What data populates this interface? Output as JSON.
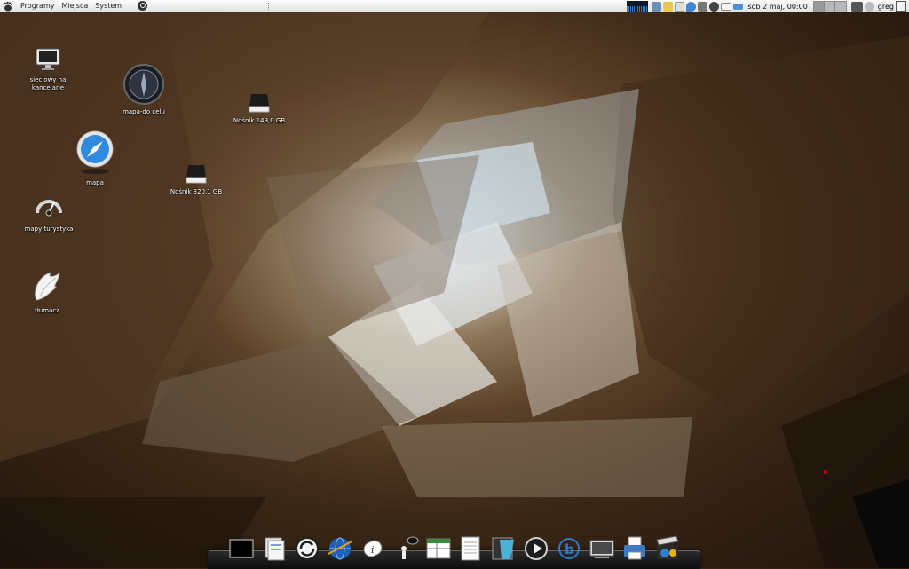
{
  "panel": {
    "menus": [
      "Programy",
      "Miejsca",
      "System"
    ],
    "clock": "sob  2 maj, 00:00",
    "user": "greg"
  },
  "desktop": {
    "icons": [
      {
        "label": "sieciowy na kancelarie",
        "icon": "monitor-icon"
      },
      {
        "label": "mapa-do celu",
        "icon": "dark-compass-icon"
      },
      {
        "label": "Nośnik 149,0 GB",
        "icon": "drive-icon"
      },
      {
        "label": "mapa",
        "icon": "safari-compass-icon"
      },
      {
        "label": "Nośnik 320,1 GB",
        "icon": "drive-icon"
      },
      {
        "label": "mapy turystyka",
        "icon": "gauge-icon"
      },
      {
        "label": "tłumacz",
        "icon": "wing-icon"
      }
    ]
  },
  "dock": {
    "items": [
      "terminal-icon",
      "files-icon",
      "sync-icon",
      "browser-globe-icon",
      "info-icon",
      "chat-icon",
      "spreadsheet-icon",
      "text-document-icon",
      "drawing-icon",
      "media-player-icon",
      "bluetooth-icon",
      "display-icon",
      "printer-icon",
      "clapperboard-icon"
    ]
  },
  "colors": {
    "panel": "#ececec",
    "shelf": "#111111",
    "label_text": "#ffffff"
  }
}
